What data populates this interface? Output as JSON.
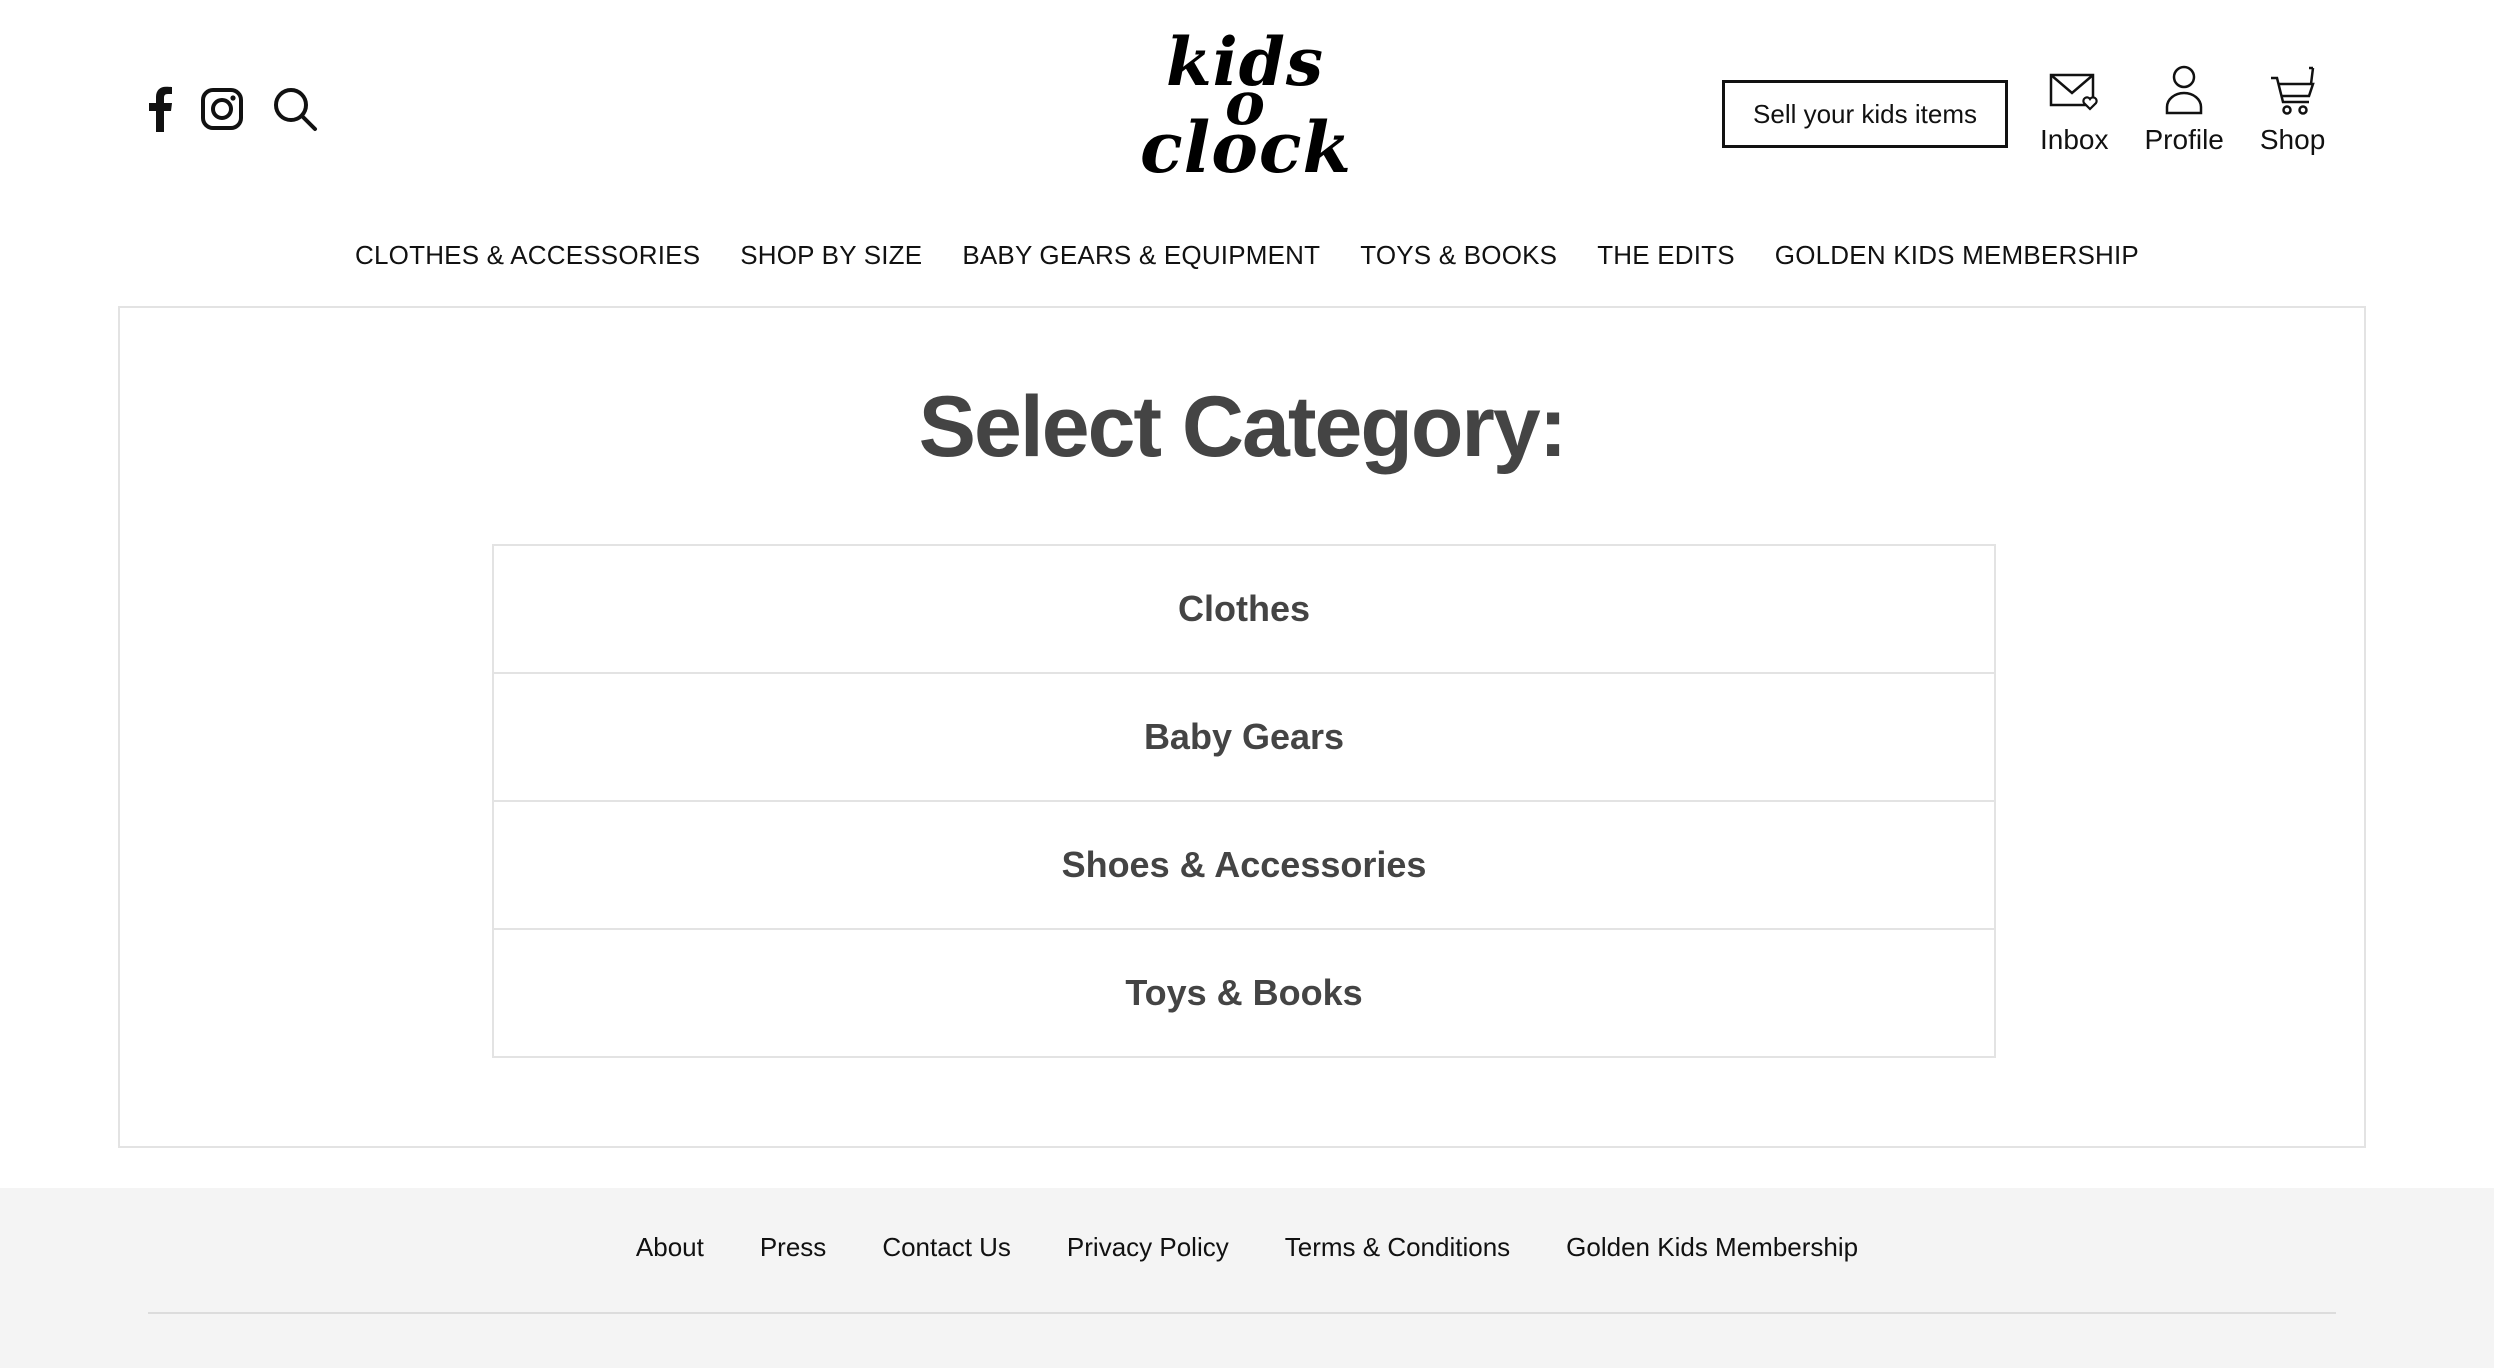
{
  "header": {
    "logo": {
      "line1": "kids",
      "line2": "o",
      "line3": "clock"
    },
    "social_icons": [
      "facebook-icon",
      "instagram-icon",
      "search-icon"
    ],
    "sell_button": "Sell your kids items",
    "user_nav": [
      {
        "label": "Inbox",
        "icon": "inbox-icon"
      },
      {
        "label": "Profile",
        "icon": "profile-icon"
      },
      {
        "label": "Shop",
        "icon": "cart-icon"
      }
    ]
  },
  "main_nav": [
    "CLOTHES & ACCESSORIES",
    "SHOP BY SIZE",
    "BABY GEARS & EQUIPMENT",
    "TOYS & BOOKS",
    "THE EDITS",
    "GOLDEN KIDS MEMBERSHIP"
  ],
  "content": {
    "title": "Select Category:",
    "categories": [
      "Clothes",
      "Baby Gears",
      "Shoes & Accessories",
      "Toys & Books"
    ]
  },
  "footer": {
    "links": [
      "About",
      "Press",
      "Contact Us",
      "Privacy Policy",
      "Terms & Conditions",
      "Golden Kids Membership"
    ]
  },
  "colors": {
    "text": "#111111",
    "heading": "#444444",
    "border": "#e3e3e3",
    "footer_bg": "#f4f4f4"
  }
}
